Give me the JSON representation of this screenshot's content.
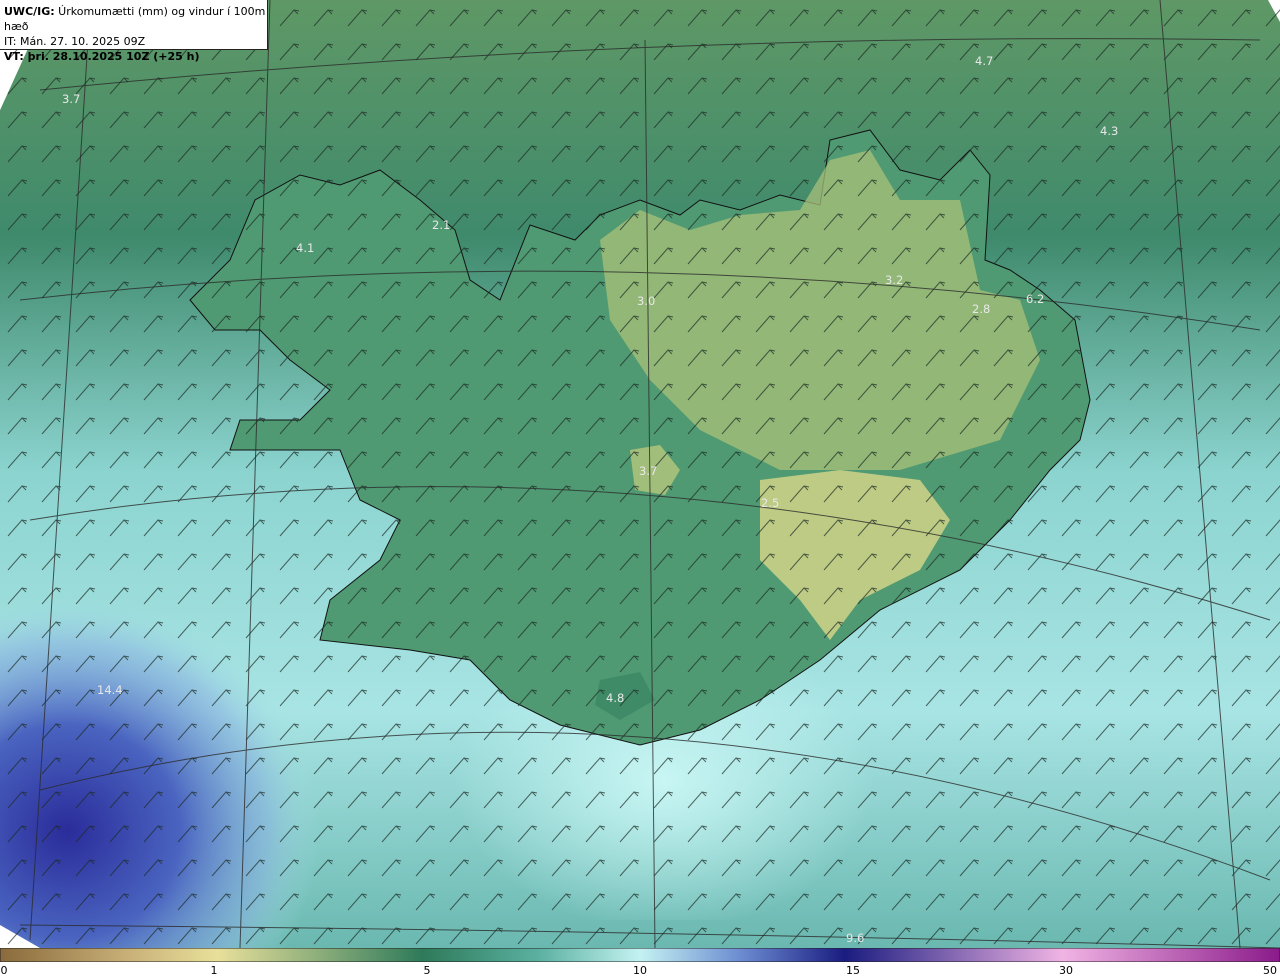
{
  "header": {
    "line1_bold": "UWC/IG:",
    "line1_text": " Úrkomumætti (mm) og vindur í 100m hæð",
    "line2": "IT: Mán. 27. 10. 2025 09Z",
    "line3_bold": "VT:",
    "line3_text": " þri. 28.10.2025 10Z (+25 h)"
  },
  "values": [
    {
      "label": "3.7"
    },
    {
      "label": "4.7"
    },
    {
      "label": "4.3"
    },
    {
      "label": "4.1"
    },
    {
      "label": "2.1"
    },
    {
      "label": "3.0"
    },
    {
      "label": "3.2"
    },
    {
      "label": "2.8"
    },
    {
      "label": "6.2"
    },
    {
      "label": "3.7"
    },
    {
      "label": "2.5"
    },
    {
      "label": "4.8"
    },
    {
      "label": "14.4"
    },
    {
      "label": "9.6"
    }
  ],
  "colorbar": {
    "ticks": [
      "0",
      "1",
      "5",
      "10",
      "15",
      "30",
      "50"
    ],
    "colors": [
      "#8a6a3c",
      "#e8e09a",
      "#2e7a5a",
      "#c4f2f2",
      "#1a1c80",
      "#f0b4e4",
      "#8a1a8a"
    ]
  }
}
